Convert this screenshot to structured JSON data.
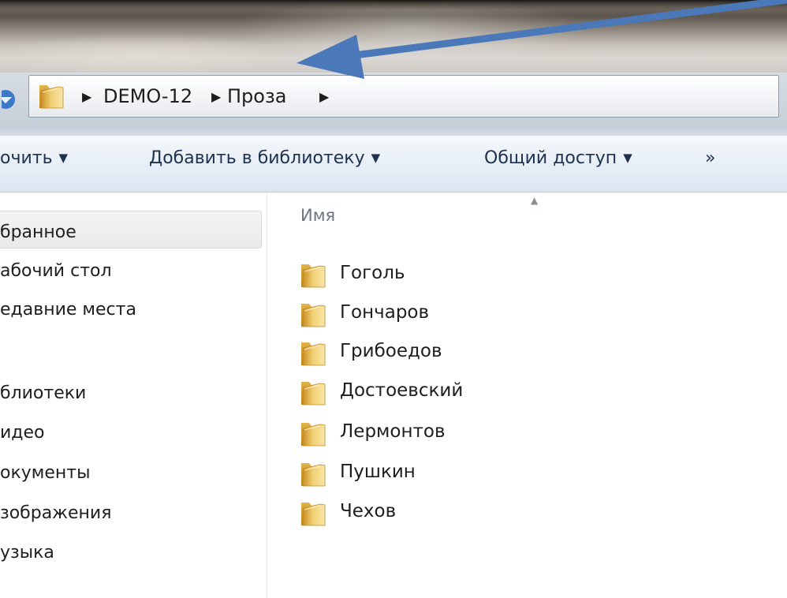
{
  "address": {
    "crumbs": [
      "DEMO-12",
      "Проза"
    ]
  },
  "toolbar": {
    "organize_label": "очить",
    "add_to_library_label": "Добавить в библиотеку",
    "share_label": "Общий доступ",
    "more_label": "»"
  },
  "nav": {
    "favorites_label": "бранное",
    "desktop_label": "абочий стол",
    "recent_label": "едавние места",
    "libraries_label": "блиотеки",
    "video_label": "идео",
    "documents_label": "окументы",
    "pictures_label": "зображения",
    "music_label": "узыка"
  },
  "filelist": {
    "column_name": "Имя",
    "items": [
      "Гоголь",
      "Гончаров",
      "Грибоедов",
      "Достоевский",
      "Лермонтов",
      "Пушкин",
      "Чехов"
    ]
  },
  "colors": {
    "annotation_arrow": "#4a78b8",
    "folder_light": "#f6dc8c",
    "folder_dark": "#d9a83a"
  },
  "icons": {
    "folder": "folder-icon",
    "dropdown": "caret-down-icon",
    "breadcrumb_separator": "triangle-right-icon",
    "back_navigation": "down-arrow-icon"
  }
}
